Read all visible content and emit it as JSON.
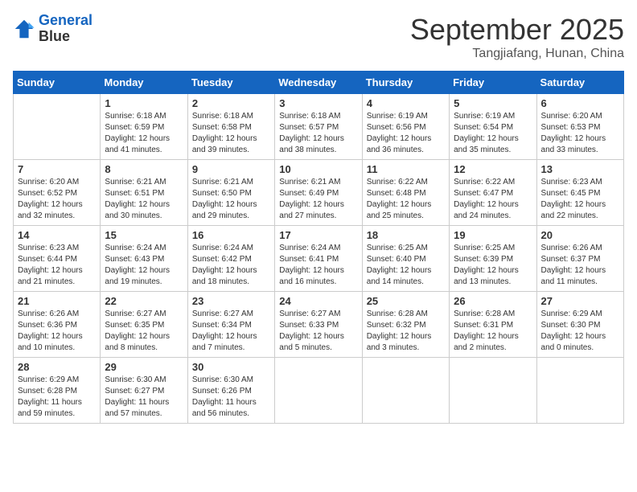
{
  "header": {
    "logo_line1": "General",
    "logo_line2": "Blue",
    "month": "September 2025",
    "location": "Tangjiafang, Hunan, China"
  },
  "weekdays": [
    "Sunday",
    "Monday",
    "Tuesday",
    "Wednesday",
    "Thursday",
    "Friday",
    "Saturday"
  ],
  "weeks": [
    [
      {
        "day": "",
        "info": ""
      },
      {
        "day": "1",
        "info": "Sunrise: 6:18 AM\nSunset: 6:59 PM\nDaylight: 12 hours\nand 41 minutes."
      },
      {
        "day": "2",
        "info": "Sunrise: 6:18 AM\nSunset: 6:58 PM\nDaylight: 12 hours\nand 39 minutes."
      },
      {
        "day": "3",
        "info": "Sunrise: 6:18 AM\nSunset: 6:57 PM\nDaylight: 12 hours\nand 38 minutes."
      },
      {
        "day": "4",
        "info": "Sunrise: 6:19 AM\nSunset: 6:56 PM\nDaylight: 12 hours\nand 36 minutes."
      },
      {
        "day": "5",
        "info": "Sunrise: 6:19 AM\nSunset: 6:54 PM\nDaylight: 12 hours\nand 35 minutes."
      },
      {
        "day": "6",
        "info": "Sunrise: 6:20 AM\nSunset: 6:53 PM\nDaylight: 12 hours\nand 33 minutes."
      }
    ],
    [
      {
        "day": "7",
        "info": "Sunrise: 6:20 AM\nSunset: 6:52 PM\nDaylight: 12 hours\nand 32 minutes."
      },
      {
        "day": "8",
        "info": "Sunrise: 6:21 AM\nSunset: 6:51 PM\nDaylight: 12 hours\nand 30 minutes."
      },
      {
        "day": "9",
        "info": "Sunrise: 6:21 AM\nSunset: 6:50 PM\nDaylight: 12 hours\nand 29 minutes."
      },
      {
        "day": "10",
        "info": "Sunrise: 6:21 AM\nSunset: 6:49 PM\nDaylight: 12 hours\nand 27 minutes."
      },
      {
        "day": "11",
        "info": "Sunrise: 6:22 AM\nSunset: 6:48 PM\nDaylight: 12 hours\nand 25 minutes."
      },
      {
        "day": "12",
        "info": "Sunrise: 6:22 AM\nSunset: 6:47 PM\nDaylight: 12 hours\nand 24 minutes."
      },
      {
        "day": "13",
        "info": "Sunrise: 6:23 AM\nSunset: 6:45 PM\nDaylight: 12 hours\nand 22 minutes."
      }
    ],
    [
      {
        "day": "14",
        "info": "Sunrise: 6:23 AM\nSunset: 6:44 PM\nDaylight: 12 hours\nand 21 minutes."
      },
      {
        "day": "15",
        "info": "Sunrise: 6:24 AM\nSunset: 6:43 PM\nDaylight: 12 hours\nand 19 minutes."
      },
      {
        "day": "16",
        "info": "Sunrise: 6:24 AM\nSunset: 6:42 PM\nDaylight: 12 hours\nand 18 minutes."
      },
      {
        "day": "17",
        "info": "Sunrise: 6:24 AM\nSunset: 6:41 PM\nDaylight: 12 hours\nand 16 minutes."
      },
      {
        "day": "18",
        "info": "Sunrise: 6:25 AM\nSunset: 6:40 PM\nDaylight: 12 hours\nand 14 minutes."
      },
      {
        "day": "19",
        "info": "Sunrise: 6:25 AM\nSunset: 6:39 PM\nDaylight: 12 hours\nand 13 minutes."
      },
      {
        "day": "20",
        "info": "Sunrise: 6:26 AM\nSunset: 6:37 PM\nDaylight: 12 hours\nand 11 minutes."
      }
    ],
    [
      {
        "day": "21",
        "info": "Sunrise: 6:26 AM\nSunset: 6:36 PM\nDaylight: 12 hours\nand 10 minutes."
      },
      {
        "day": "22",
        "info": "Sunrise: 6:27 AM\nSunset: 6:35 PM\nDaylight: 12 hours\nand 8 minutes."
      },
      {
        "day": "23",
        "info": "Sunrise: 6:27 AM\nSunset: 6:34 PM\nDaylight: 12 hours\nand 7 minutes."
      },
      {
        "day": "24",
        "info": "Sunrise: 6:27 AM\nSunset: 6:33 PM\nDaylight: 12 hours\nand 5 minutes."
      },
      {
        "day": "25",
        "info": "Sunrise: 6:28 AM\nSunset: 6:32 PM\nDaylight: 12 hours\nand 3 minutes."
      },
      {
        "day": "26",
        "info": "Sunrise: 6:28 AM\nSunset: 6:31 PM\nDaylight: 12 hours\nand 2 minutes."
      },
      {
        "day": "27",
        "info": "Sunrise: 6:29 AM\nSunset: 6:30 PM\nDaylight: 12 hours\nand 0 minutes."
      }
    ],
    [
      {
        "day": "28",
        "info": "Sunrise: 6:29 AM\nSunset: 6:28 PM\nDaylight: 11 hours\nand 59 minutes."
      },
      {
        "day": "29",
        "info": "Sunrise: 6:30 AM\nSunset: 6:27 PM\nDaylight: 11 hours\nand 57 minutes."
      },
      {
        "day": "30",
        "info": "Sunrise: 6:30 AM\nSunset: 6:26 PM\nDaylight: 11 hours\nand 56 minutes."
      },
      {
        "day": "",
        "info": ""
      },
      {
        "day": "",
        "info": ""
      },
      {
        "day": "",
        "info": ""
      },
      {
        "day": "",
        "info": ""
      }
    ]
  ]
}
